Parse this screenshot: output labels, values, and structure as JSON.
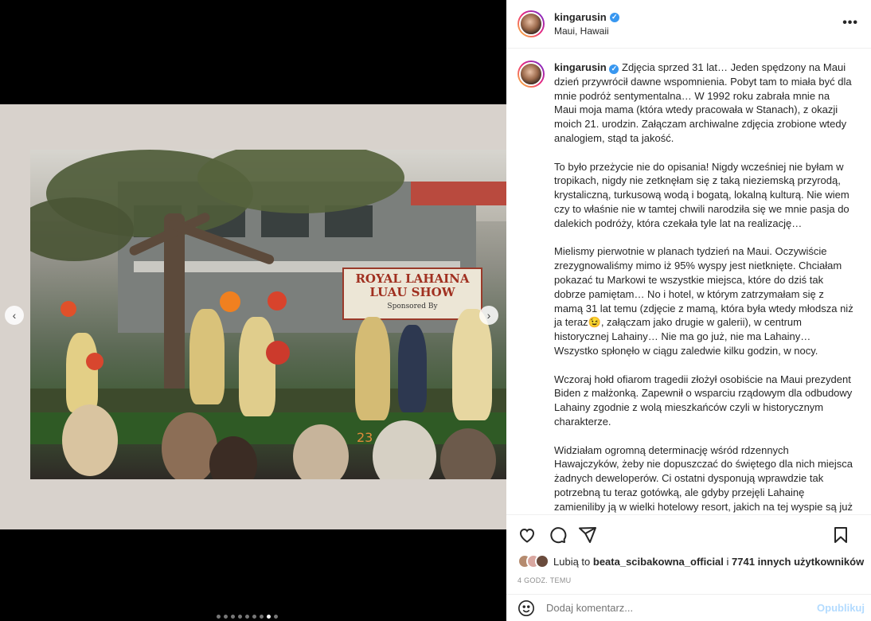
{
  "post": {
    "username": "kingarusin",
    "location": "Maui, Hawaii",
    "more_label": "•••"
  },
  "photo": {
    "banner_title_1": "ROYAL LAHAINA",
    "banner_title_2": "LUAU SHOW",
    "banner_sub": "Sponsored By",
    "stage_number": "23"
  },
  "carousel": {
    "prev_label": "‹",
    "next_label": "›",
    "total": 9,
    "active_index": 7
  },
  "caption": {
    "intro": "Zdjęcia sprzed 31 lat… Jeden spędzony na Maui dzień przywrócił dawne wspomnienia. Pobyt tam to miała być dla mnie podróż sentymentalna… W 1992 roku zabrała mnie na Maui moja mama (która wtedy pracowała w Stanach), z okazji moich 21. urodzin. Załączam archiwalne zdjęcia zrobione wtedy analogiem, stąd ta jakość.",
    "p2": "To było przeżycie nie do opisania! Nigdy wcześniej nie byłam w tropikach, nigdy nie zetknęłam się z taką nieziemską przyrodą, krystaliczną, turkusową wodą i bogatą, lokalną kulturą. Nie wiem czy to właśnie nie w tamtej chwili narodziła się we mnie pasja do dalekich podróży, która czekała tyle lat na realizację…",
    "p3": "Mielismy pierwotnie w planach tydzień na Maui. Oczywiście zrezygnowaliśmy mimo iż 95% wyspy jest nietknięte. Chciałam pokazać tu Markowi te wszystkie miejsca, które do dziś tak dobrze pamiętam… No i hotel, w którym zatrzymałam się z mamą 31 lat temu (zdjęcie z mamą, która była wtedy młodsza niż ja teraz😉, załączam jako drugie w galerii), w centrum historycznej Lahainy… Nie ma go już, nie ma Lahainy…Wszystko spłonęło w ciągu zaledwie kilku godzin, w nocy.",
    "p4": "Wczoraj hołd ofiarom tragedii złożył osobiście na Maui prezydent Biden z małżonką. Zapewnił o wsparciu rządowym dla odbudowy Lahainy zgodnie z wolą mieszkańców czyli w historycznym charakterze.",
    "p5": "Widziałam ogromną determinację wśród rdzennych Hawajczyków, żeby nie dopuszczać do świętego dla nich miejsca żadnych deweloperów. Ci ostatni dysponują wprawdzie tak potrzebną tu teraz gotówką, ale gdyby przejęli Lahainę zamieniliby ją w wielki hotelowy resort, jakich na tej wyspie są już dziesiątki. Teraz po publicznej deklaracji prezydenta tym bardziej jestem pewna, że Hawajczycy odbudują miasto na własnych zasadach, że stanie się"
  },
  "likes": {
    "prefix": "Lubią to",
    "user": "beata_scibakowna_official",
    "connector": "i",
    "others": "7741 innych użytkowników"
  },
  "time_label": "4 GODZ. TEMU",
  "comment": {
    "placeholder": "Dodaj komentarz...",
    "publish_label": "Opublikuj"
  },
  "colors": {
    "accent_blue": "#3897f0",
    "publish_disabled": "#b3dbff",
    "muted": "#8e8e8e"
  }
}
